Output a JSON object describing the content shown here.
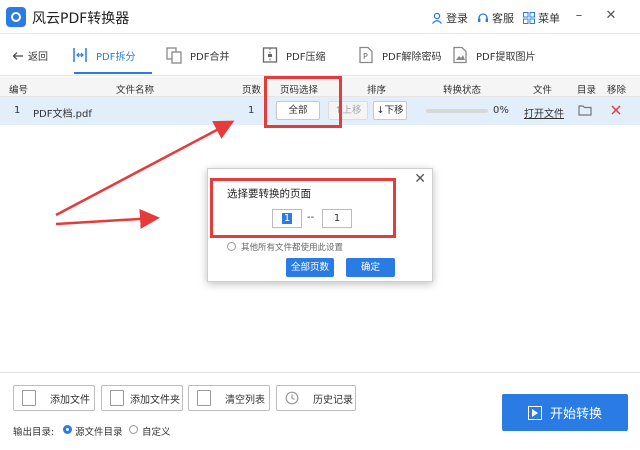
{
  "app": {
    "title": "风云PDF转换器"
  },
  "titlebar": {
    "login": "登录",
    "service": "客服",
    "menu": "菜单"
  },
  "nav": {
    "back": "返回",
    "tabs": [
      {
        "label": "PDF拆分",
        "active": true
      },
      {
        "label": "PDF合并"
      },
      {
        "label": "PDF压缩"
      },
      {
        "label": "PDF解除密码"
      },
      {
        "label": "PDF提取图片"
      }
    ]
  },
  "table": {
    "headers": [
      "编号",
      "文件名称",
      "页数",
      "页码选择",
      "排序",
      "转换状态",
      "文件",
      "目录",
      "移除"
    ],
    "rows": [
      {
        "index": "1",
        "filename": "PDF文档.pdf",
        "pages": "1",
        "page_select": "全部",
        "move_up": "上移",
        "move_down": "下移",
        "progress_percent": 0,
        "progress_text": "0%",
        "open_file": "打开文件"
      }
    ]
  },
  "dialog": {
    "title": "选择要转换的页面",
    "from_page": "1",
    "separator": "--",
    "to_page": "1",
    "apply_all": "其他所有文件都使用此设置",
    "all_pages_button": "全部页数",
    "confirm_button": "确定"
  },
  "bottom": {
    "add_file": "添加文件",
    "add_folder": "添加文件夹",
    "clear_list": "清空列表",
    "history": "历史记录",
    "output_label": "输出目录:",
    "source_dir": "源文件目录",
    "custom": "自定义",
    "start": "开始转换"
  },
  "colors": {
    "accent": "#2a7be4",
    "annotation": "#e63b3b",
    "row_highlight": "#e3eefb"
  }
}
